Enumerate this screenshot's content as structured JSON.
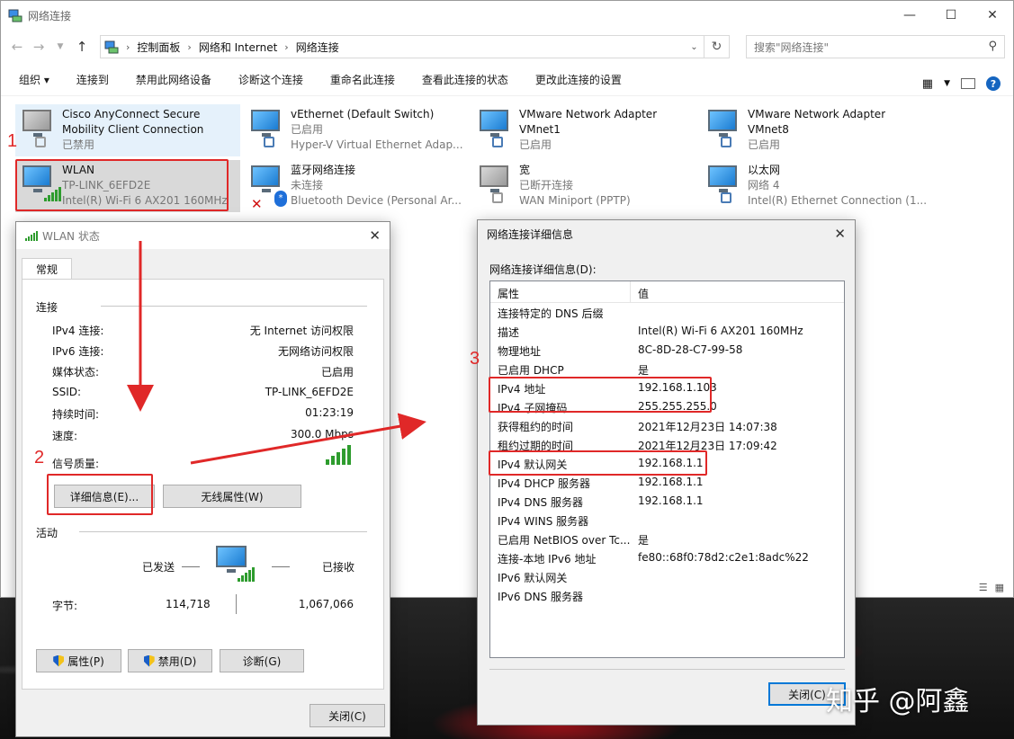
{
  "explorer": {
    "title": "网络连接",
    "breadcrumb": [
      "控制面板",
      "网络和 Internet",
      "网络连接"
    ],
    "search_placeholder": "搜索\"网络连接\"",
    "commands": [
      "组织 ▾",
      "连接到",
      "禁用此网络设备",
      "诊断这个连接",
      "重命名此连接",
      "查看此连接的状态",
      "更改此连接的设置"
    ],
    "adapters": [
      {
        "name": "Cisco AnyConnect Secure",
        "line2": "Mobility Client Connection",
        "line3": "已禁用",
        "icon": "network-disabled-icon"
      },
      {
        "name": "vEthernet (Default Switch)",
        "line2": "已启用",
        "line3": "Hyper-V Virtual Ethernet Adap...",
        "icon": "network-icon"
      },
      {
        "name": "VMware Network Adapter",
        "line2": "VMnet1",
        "line3": "已启用",
        "icon": "network-icon"
      },
      {
        "name": "VMware Network Adapter",
        "line2": "VMnet8",
        "line3": "已启用",
        "icon": "network-icon"
      },
      {
        "name": "WLAN",
        "line2": "TP-LINK_6EFD2E",
        "line3": "Intel(R) Wi-Fi 6 AX201 160MHz",
        "icon": "wifi-icon"
      },
      {
        "name": "蓝牙网络连接",
        "line2": "未连接",
        "line3": "Bluetooth Device (Personal Ar...",
        "icon": "bluetooth-icon"
      },
      {
        "name": "宽",
        "line2": "已断开连接",
        "line3": "WAN Miniport (PPTP)",
        "icon": "network-disconnected-icon"
      },
      {
        "name": "以太网",
        "line2": "网络 4",
        "line3": "Intel(R) Ethernet Connection (1...",
        "icon": "network-icon"
      }
    ]
  },
  "wlan_status": {
    "title": "WLAN 状态",
    "tab": "常规",
    "connection_group": "连接",
    "rows": [
      {
        "k": "IPv4 连接:",
        "v": "无 Internet 访问权限"
      },
      {
        "k": "IPv6 连接:",
        "v": "无网络访问权限"
      },
      {
        "k": "媒体状态:",
        "v": "已启用"
      },
      {
        "k": "SSID:",
        "v": "TP-LINK_6EFD2E"
      },
      {
        "k": "持续时间:",
        "v": "01:23:19"
      },
      {
        "k": "速度:",
        "v": "300.0 Mbps"
      }
    ],
    "signal_label": "信号质量:",
    "details_button": "详细信息(E)...",
    "wireless_button": "无线属性(W)",
    "activity_group": "活动",
    "sent_label": "已发送",
    "received_label": "已接收",
    "bytes_label": "字节:",
    "bytes_sent": "114,718",
    "bytes_received": "1,067,066",
    "properties_button": "属性(P)",
    "disable_button": "禁用(D)",
    "diagnose_button": "诊断(G)",
    "close_button": "关闭(C)"
  },
  "details": {
    "title": "网络连接详细信息",
    "label": "网络连接详细信息(D):",
    "col_property": "属性",
    "col_value": "值",
    "rows": [
      {
        "p": "连接特定的 DNS 后缀",
        "v": ""
      },
      {
        "p": "描述",
        "v": "Intel(R) Wi-Fi 6 AX201 160MHz"
      },
      {
        "p": "物理地址",
        "v": "8C-8D-28-C7-99-58"
      },
      {
        "p": "已启用 DHCP",
        "v": "是"
      },
      {
        "p": "IPv4 地址",
        "v": "192.168.1.103"
      },
      {
        "p": "IPv4 子网掩码",
        "v": "255.255.255.0"
      },
      {
        "p": "获得租约的时间",
        "v": "2021年12月23日 14:07:38"
      },
      {
        "p": "租约过期的时间",
        "v": "2021年12月23日 17:09:42"
      },
      {
        "p": "IPv4 默认网关",
        "v": "192.168.1.1"
      },
      {
        "p": "IPv4 DHCP 服务器",
        "v": "192.168.1.1"
      },
      {
        "p": "IPv4 DNS 服务器",
        "v": "192.168.1.1"
      },
      {
        "p": "IPv4 WINS 服务器",
        "v": ""
      },
      {
        "p": "已启用 NetBIOS over Tc...",
        "v": "是"
      },
      {
        "p": "连接-本地 IPv6 地址",
        "v": "fe80::68f0:78d2:c2e1:8adc%22"
      },
      {
        "p": "IPv6 默认网关",
        "v": ""
      },
      {
        "p": "IPv6 DNS 服务器",
        "v": ""
      }
    ],
    "close_button": "关闭(C)"
  },
  "annotations": {
    "n1": "1",
    "n2": "2",
    "n3": "3"
  },
  "watermark": "知乎 @阿鑫",
  "colors": {
    "annotation_red": "#e02828",
    "accent": "#0078d7"
  }
}
